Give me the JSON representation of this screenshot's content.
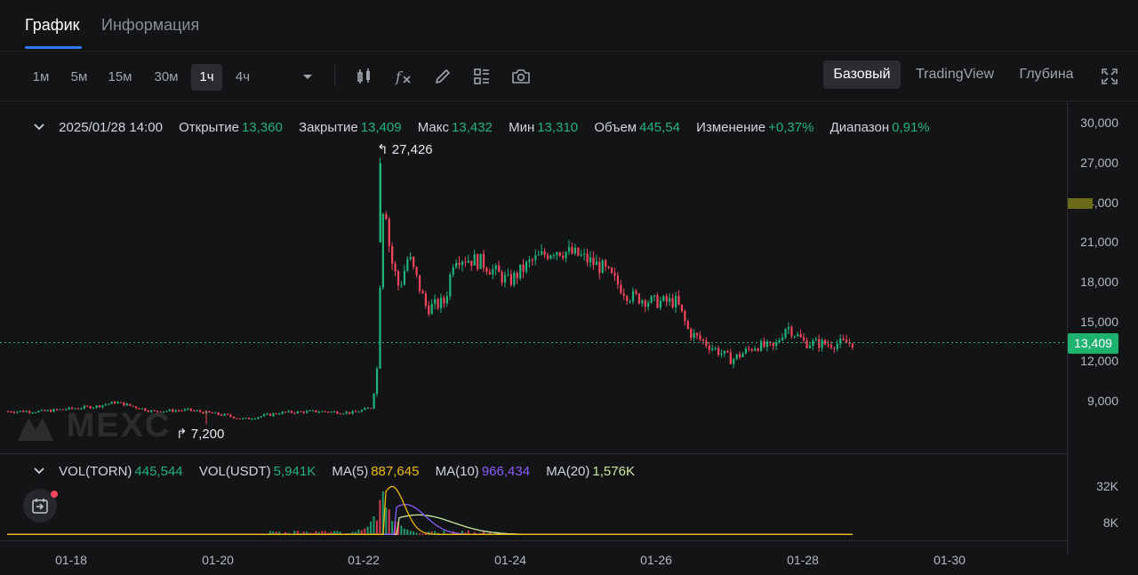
{
  "tabs": [
    {
      "label": "График",
      "active": true
    },
    {
      "label": "Информация",
      "active": false
    }
  ],
  "toolbar": {
    "intervals": [
      {
        "label": "1м",
        "active": false
      },
      {
        "label": "5м",
        "active": false
      },
      {
        "label": "15м",
        "active": false
      },
      {
        "label": "30м",
        "active": false
      },
      {
        "label": "1ч",
        "active": true
      },
      {
        "label": "4ч",
        "active": false
      }
    ],
    "tools": [
      "candle-type-icon",
      "indicators-icon",
      "drawing-pencil-icon",
      "layout-settings-icon",
      "screenshot-camera-icon"
    ],
    "views": [
      {
        "label": "Базовый",
        "active": true
      },
      {
        "label": "TradingView",
        "active": false
      },
      {
        "label": "Глубина",
        "active": false
      }
    ]
  },
  "ohlc": {
    "date": "2025/01/28 14:00",
    "open_label": "Открытие",
    "open": "13,360",
    "close_label": "Закрытие",
    "close": "13,409",
    "high_label": "Макс",
    "high": "13,432",
    "low_label": "Мин",
    "low": "13,310",
    "volume_label": "Объем",
    "volume": "445,54",
    "change_label": "Изменение",
    "change": "+0,37%",
    "range_label": "Диапазон",
    "range": "0,91%"
  },
  "volume_legend": {
    "vol_torn_label": "VOL(TORN)",
    "vol_torn": "445,544",
    "vol_usdt_label": "VOL(USDT)",
    "vol_usdt": "5,941K",
    "ma5_label": "MA(5)",
    "ma5": "887,645",
    "ma10_label": "MA(10)",
    "ma10": "966,434",
    "ma20_label": "MA(20)",
    "ma20": "1,576K"
  },
  "price_axis": [
    "30,000",
    "27,000",
    "24,000",
    "21,000",
    "18,000",
    "15,000",
    "12,000",
    "9,000"
  ],
  "volume_axis": [
    "32K",
    "8K"
  ],
  "time_axis": [
    "01-18",
    "01-20",
    "01-22",
    "01-24",
    "01-26",
    "01-28",
    "01-30"
  ],
  "annotations": {
    "high": "27,426",
    "low": "7,200"
  },
  "last_price": "13,409",
  "watermark": "MEXC",
  "colors": {
    "up": "#22b37a",
    "down": "#f6465d",
    "accent": "#2f7bf6",
    "ma5": "#f0b90b",
    "ma10": "#8b5cf6",
    "ma20": "#c9e89a"
  },
  "chart_data": {
    "type": "candlestick",
    "symbol": "TORN",
    "interval": "1ч",
    "price_range": [
      6000,
      31000
    ],
    "volume_range": [
      0,
      40000
    ],
    "x_range": [
      "01-17",
      "01-31"
    ],
    "price_trend": [
      [
        "01-17 12:00",
        8200
      ],
      [
        "01-18 06:00",
        8600
      ],
      [
        "01-18 12:00",
        8900
      ],
      [
        "01-19 00:00",
        8200
      ],
      [
        "01-19 12:00",
        8300
      ],
      [
        "01-20 00:00",
        7900
      ],
      [
        "01-20 06:00",
        7600
      ],
      [
        "01-20 18:00",
        8100
      ],
      [
        "01-21 06:00",
        8200
      ],
      [
        "01-21 18:00",
        8100
      ],
      [
        "01-22 00:00",
        8500
      ],
      [
        "01-22 02:00",
        12000
      ],
      [
        "01-22 03:00",
        21000
      ],
      [
        "01-22 04:00",
        25000
      ],
      [
        "01-22 06:00",
        20000
      ],
      [
        "01-22 09:00",
        17500
      ],
      [
        "01-22 12:00",
        20000
      ],
      [
        "01-22 18:00",
        16000
      ],
      [
        "01-23 00:00",
        16500
      ],
      [
        "01-23 03:00",
        20000
      ],
      [
        "01-23 12:00",
        19500
      ],
      [
        "01-23 21:00",
        18000
      ],
      [
        "01-24 04:00",
        19500
      ],
      [
        "01-24 12:00",
        20500
      ],
      [
        "01-24 20:00",
        20000
      ],
      [
        "01-25 04:00",
        19000
      ],
      [
        "01-25 12:00",
        17000
      ],
      [
        "01-25 20:00",
        16500
      ],
      [
        "01-26 04:00",
        16500
      ],
      [
        "01-26 08:00",
        14200
      ],
      [
        "01-26 16:00",
        13000
      ],
      [
        "01-26 22:00",
        12100
      ],
      [
        "01-27 06:00",
        13200
      ],
      [
        "01-27 12:00",
        13000
      ],
      [
        "01-27 16:00",
        14700
      ],
      [
        "01-27 22:00",
        13400
      ],
      [
        "01-28 06:00",
        13300
      ],
      [
        "01-28 14:00",
        13409
      ]
    ],
    "annotations": [
      {
        "label": "27,426",
        "kind": "high"
      },
      {
        "label": "7,200",
        "kind": "low"
      }
    ],
    "last_price": 13409,
    "volume_spike": {
      "center": "01-22 04:00",
      "peak": 33000
    },
    "ma_peaks": {
      "ma5": 32000,
      "ma10": 20000,
      "ma20": 13000
    },
    "xlabel": "",
    "ylabel": "",
    "grid": false
  }
}
